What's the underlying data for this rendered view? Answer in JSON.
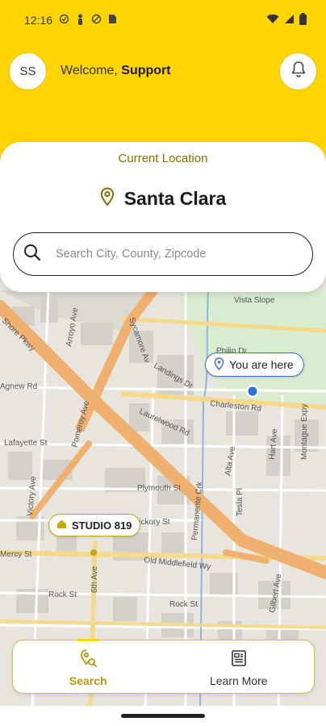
{
  "status_bar": {
    "time": "12:16"
  },
  "header": {
    "avatar_initials": "SS",
    "welcome_prefix": "Welcome, ",
    "user_name": "Support",
    "brand_color": "#FFD400"
  },
  "location_card": {
    "label": "Current Location",
    "city": "Santa Clara",
    "search_placeholder": "Search City, County, Zipcode"
  },
  "map": {
    "you_are_here": "You are here",
    "studio_label": "STUDIO 819",
    "street_labels": {
      "shore": "Shore Pkwy",
      "arroyo": "Arroyo Ave",
      "sycamore": "Sycamore Av",
      "agnew": "Agnew Rd",
      "lafayette": "Lafayette St",
      "pomeroy": "Pomeroy Ave",
      "laurelwood": "Laurelwood Rd",
      "charleston": "Charleston Rd",
      "vista": "Vista Slope",
      "philip": "Philip Dr",
      "landings": "Landings Dr",
      "alta": "Alta Ave",
      "hart": "Hart Ave",
      "permanente": "Permanente Crk",
      "tesla": "Tesla Pl",
      "plymouth": "Plymouth St",
      "montague": "Montague Expy",
      "old_middlefield": "Old Middlefield Wy",
      "rock1": "Rock St",
      "rock2": "Rock St",
      "mercy": "Mercy St",
      "gilbert": "Gilbert Ave",
      "hickory": "Hickory St",
      "victory": "Victory Ave",
      "sixth": "6th Ave"
    }
  },
  "bottom_nav": {
    "items": [
      {
        "label": "Search",
        "icon": "map-search-icon",
        "active": true
      },
      {
        "label": "Learn More",
        "icon": "document-icon",
        "active": false
      }
    ]
  }
}
